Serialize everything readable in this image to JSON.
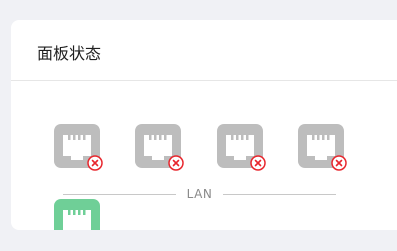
{
  "panel": {
    "title": "面板状态"
  },
  "lan": {
    "label": "LAN",
    "ports": [
      {
        "status": "disconnected",
        "color": "#bdbdbd"
      },
      {
        "status": "disconnected",
        "color": "#bdbdbd"
      },
      {
        "status": "disconnected",
        "color": "#bdbdbd"
      },
      {
        "status": "disconnected",
        "color": "#bdbdbd"
      }
    ]
  },
  "wan": {
    "ports": [
      {
        "status": "connected",
        "color": "#6fcf97"
      }
    ]
  },
  "colors": {
    "error_badge": "#e8262d",
    "background": "#f0f1f5",
    "card": "#ffffff"
  }
}
